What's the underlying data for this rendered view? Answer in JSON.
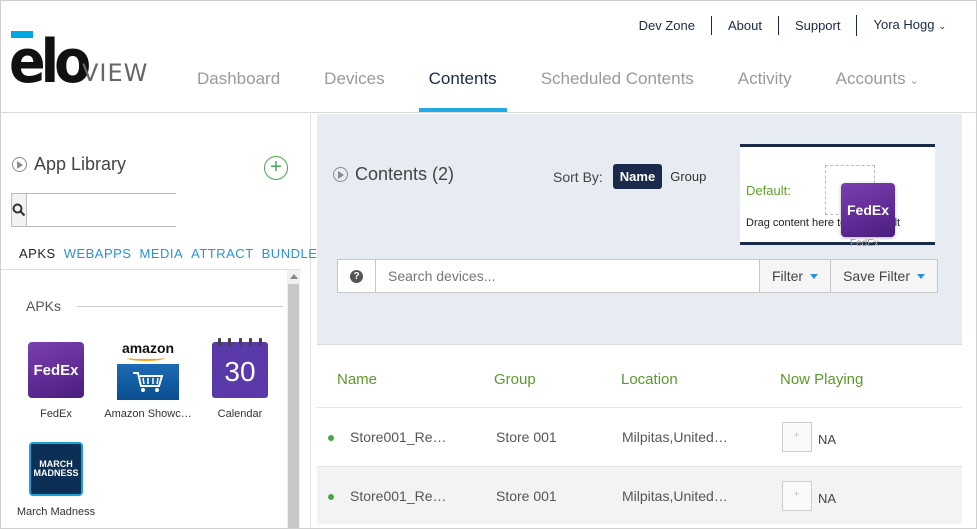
{
  "brand": {
    "name": "elo",
    "product": "VIEW"
  },
  "toplinks": [
    "Dev Zone",
    "About",
    "Support",
    "Yora Hogg"
  ],
  "nav": {
    "tabs": [
      "Dashboard",
      "Devices",
      "Contents",
      "Scheduled Contents",
      "Activity",
      "Accounts"
    ],
    "active": "Contents"
  },
  "sidebar": {
    "title": "App Library",
    "search_placeholder": "",
    "tabs": [
      "APKS",
      "WEBAPPS",
      "MEDIA",
      "ATTRACT",
      "BUNDLE"
    ],
    "active_tab": "APKS",
    "section_label": "APKs",
    "apps": [
      {
        "name": "FedEx",
        "icon": "fedex-icon",
        "tile_text": "FedEx"
      },
      {
        "name": "Amazon Showc…",
        "icon": "amazon-icon",
        "tile_text": "amazon"
      },
      {
        "name": "Calendar",
        "icon": "calendar-icon",
        "tile_text": "30"
      },
      {
        "name": "March Madness",
        "icon": "march-madness-icon",
        "tile_text": "MARCH MADNESS"
      }
    ]
  },
  "contents": {
    "title": "Contents (2)",
    "sort_label": "Sort By:",
    "sort_options": [
      "Name",
      "Group"
    ],
    "sort_active": "Name",
    "default_label": "Default:",
    "default_hint": "Drag content here to set default",
    "default_app": "FedEx",
    "search_placeholder": "Search devices...",
    "filter_label": "Filter",
    "save_filter_label": "Save Filter"
  },
  "table": {
    "columns": [
      "Name",
      "Group",
      "Location",
      "Now Playing"
    ],
    "rows": [
      {
        "name": "Store001_Re…",
        "group": "Store 001",
        "location": "Milpitas,United…",
        "now_playing": "NA"
      },
      {
        "name": "Store001_Re…",
        "group": "Store 001",
        "location": "Milpitas,United…",
        "now_playing": "NA"
      }
    ]
  },
  "colors": {
    "accent": "#22a9e2",
    "navy": "#1a2a4a",
    "green": "#5a9a2a",
    "fedex_purple": "#4b1d7f"
  }
}
